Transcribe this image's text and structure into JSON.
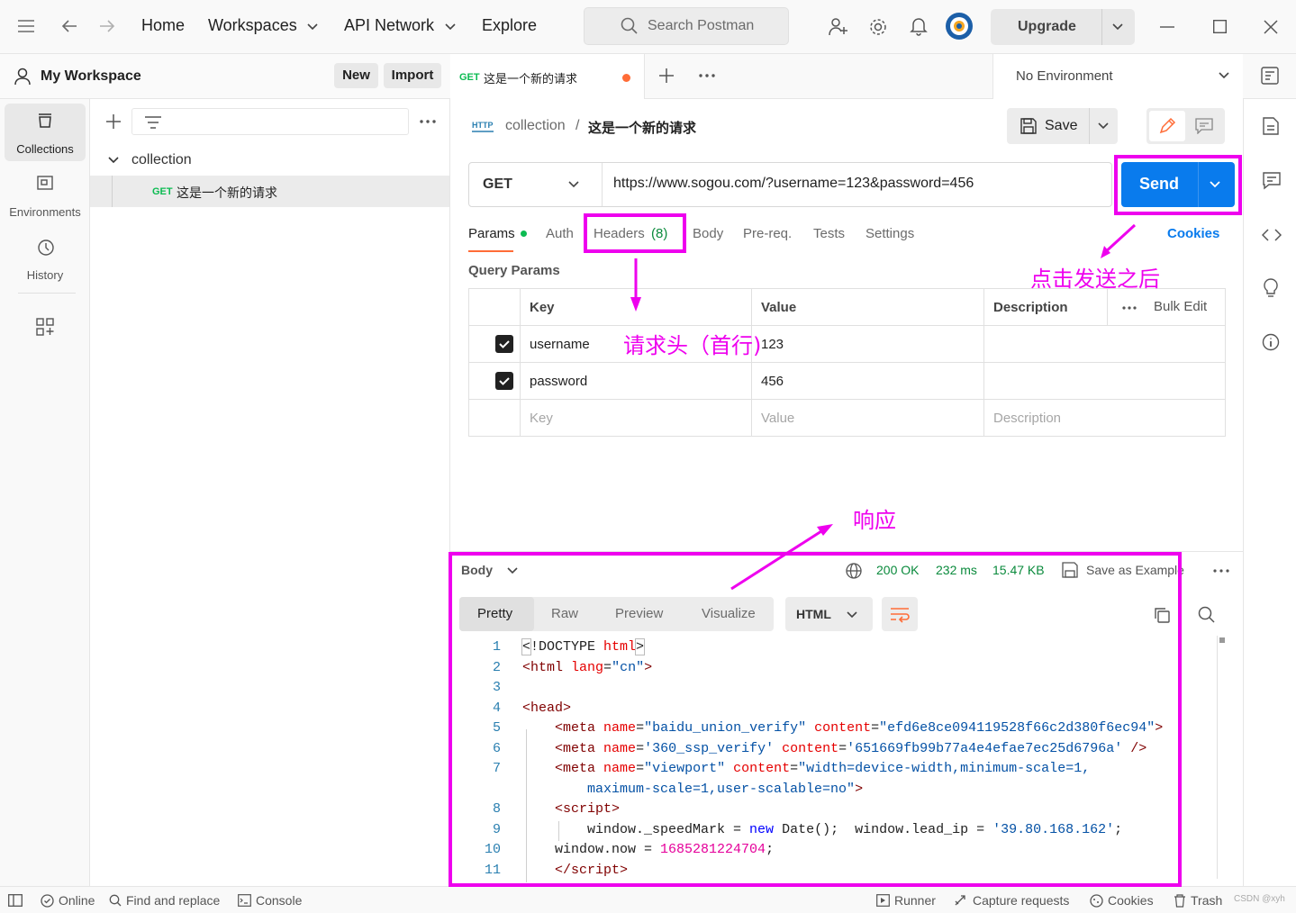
{
  "topbar": {
    "nav": [
      "Home",
      "Workspaces",
      "API Network",
      "Explore"
    ],
    "search_placeholder": "Search Postman",
    "upgrade_label": "Upgrade"
  },
  "sidebar": {
    "workspace_title": "My Workspace",
    "new_label": "New",
    "import_label": "Import",
    "rail": [
      {
        "label": "Collections",
        "icon": "collections-icon"
      },
      {
        "label": "Environments",
        "icon": "environments-icon"
      },
      {
        "label": "History",
        "icon": "history-icon"
      }
    ],
    "tree": {
      "collection_name": "collection",
      "request_method": "GET",
      "request_name": "这是一个新的请求"
    }
  },
  "tabs": {
    "active": {
      "method": "GET",
      "name": "这是一个新的请求"
    },
    "environment": "No Environment"
  },
  "request": {
    "breadcrumb_parent": "collection",
    "breadcrumb_sep": "/",
    "breadcrumb_current": "这是一个新的请求",
    "save_label": "Save",
    "method": "GET",
    "url": "https://www.sogou.com/?username=123&password=456",
    "send_label": "Send",
    "subtabs": [
      "Params",
      "Auth",
      "Headers",
      "Body",
      "Pre-req.",
      "Tests",
      "Settings"
    ],
    "headers_count": "(8)",
    "cookies_label": "Cookies",
    "query_params_title": "Query Params",
    "columns": [
      "Key",
      "Value",
      "Description"
    ],
    "bulk_edit": "Bulk Edit",
    "rows": [
      {
        "key": "username",
        "value": "123",
        "checked": true
      },
      {
        "key": "password",
        "value": "456",
        "checked": true
      }
    ],
    "placeholder_row": {
      "key": "Key",
      "value": "Value",
      "description": "Description"
    }
  },
  "response": {
    "section_label": "Body",
    "status": "200 OK",
    "time": "232 ms",
    "size": "15.47 KB",
    "save_example": "Save as Example",
    "view_tabs": [
      "Pretty",
      "Raw",
      "Preview",
      "Visualize"
    ],
    "format": "HTML",
    "line_numbers": [
      "1",
      "2",
      "3",
      "4",
      "5",
      "6",
      "7",
      "",
      "8",
      "9",
      "10",
      "11"
    ]
  },
  "statusbar": {
    "online": "Online",
    "find_replace": "Find and replace",
    "console": "Console",
    "runner": "Runner",
    "capture": "Capture requests",
    "cookies": "Cookies",
    "trash": "Trash",
    "watermark": "CSDN @xyh"
  },
  "annotations": {
    "headers_note": "请求头（首行)",
    "send_note": "点击发送之后",
    "response_note": "响应",
    "color": "#ee00ee"
  },
  "colors": {
    "send": "#097bed",
    "get": "#0cbb52",
    "status_ok": "#0a8a3c",
    "accent": "#ff6c37"
  }
}
